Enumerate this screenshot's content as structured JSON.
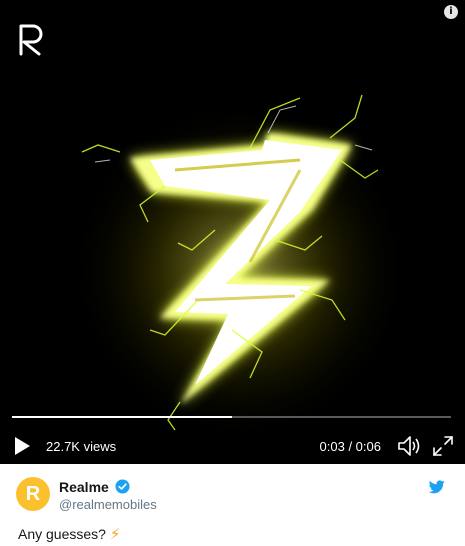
{
  "video": {
    "views": "22.7K views",
    "time": "0:03 / 0:06",
    "progress": 0.5,
    "accent": "#ffff66"
  },
  "icons": {
    "info": "info-icon",
    "logo": "realme-r-logo",
    "play": "play-icon",
    "volume": "volume-icon",
    "fullscreen": "fullscreen-icon",
    "verified": "verified-badge-icon",
    "twitter": "twitter-bird-icon"
  },
  "author": {
    "name": "Realme",
    "handle": "@realmemobiles",
    "avatar_letter": "R",
    "avatar_color": "#fbc02d"
  },
  "tweet": {
    "text": "Any guesses?",
    "emoji": "⚡"
  },
  "colors": {
    "twitter_blue": "#1da1f2",
    "text": "#14171a",
    "muted": "#657786"
  }
}
